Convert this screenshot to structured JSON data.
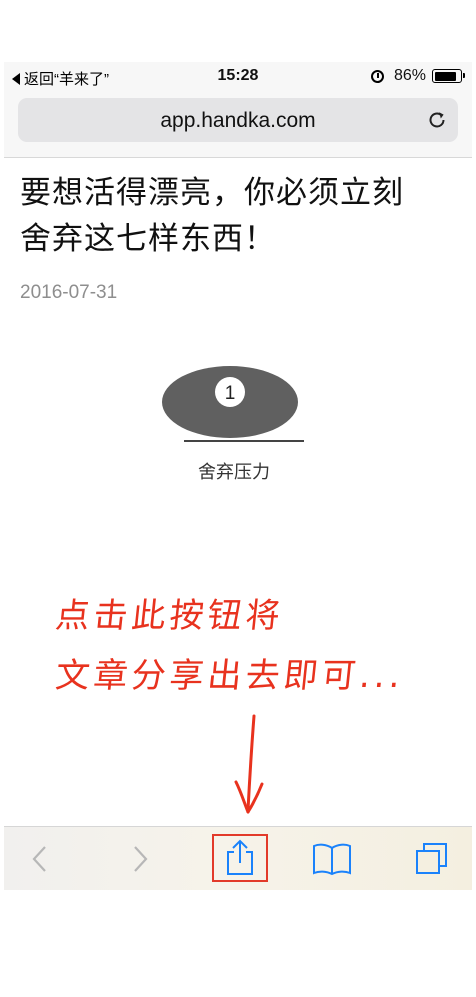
{
  "status_bar": {
    "back_label": "返回“羊来了”",
    "time": "15:28",
    "battery_percent": 86,
    "battery_label": "86%"
  },
  "url_bar": {
    "url": "app.handka.com",
    "reload_icon": "reload-icon"
  },
  "article": {
    "title_line1": "要想活得漂亮，你必须立刻",
    "title_line2": "舍弃这七样东西！",
    "date": "2016-07-31",
    "illustration": {
      "badge": "1",
      "label": "舍弃压力"
    }
  },
  "annotation": {
    "line1": "点击此按钮将",
    "line2": "文章分享出去即可...",
    "color": "#e8321e"
  },
  "toolbar": {
    "back_icon": "chevron-left-icon",
    "forward_icon": "chevron-right-icon",
    "share_icon": "share-icon",
    "bookmarks_icon": "book-icon",
    "tabs_icon": "tabs-icon",
    "accent": "#1a82fb",
    "highlight": "#e23a2a"
  }
}
